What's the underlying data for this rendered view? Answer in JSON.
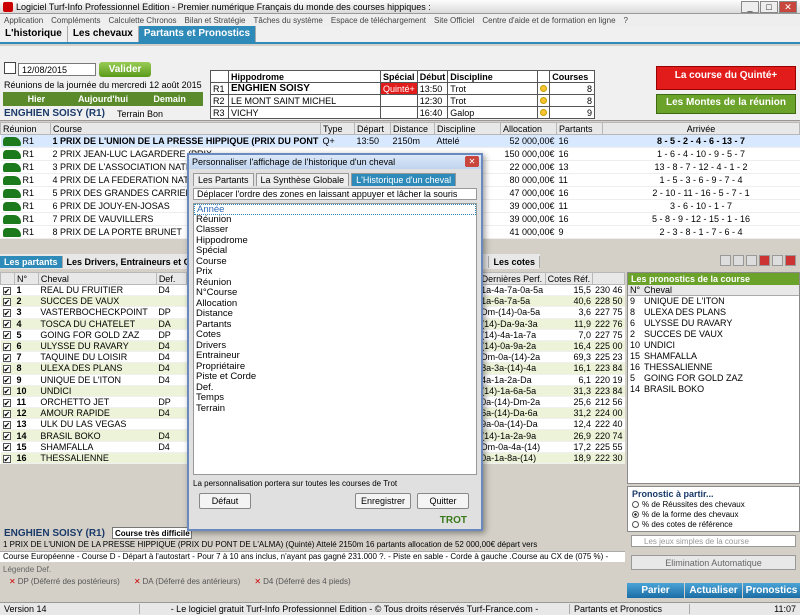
{
  "window": {
    "title": "Logiciel Turf-Info Professionnel Edition - Premier numérique Français du monde des courses hippiques :"
  },
  "menu": [
    "Application",
    "Compléments",
    "Calculette Chronos",
    "Bilan et Stratégie",
    "Tâches du système",
    "Espace de téléchargement",
    "Site Officiel",
    "Centre d'aide et de formation en ligne",
    "?"
  ],
  "tabs": [
    "L'historique",
    "Les chevaux",
    "Partants et Pronostics"
  ],
  "toolbar": {
    "date": "12/08/2015",
    "valider": "Valider",
    "reunions_date": "Réunions de la journée du mercredi 12 août 2015",
    "nav": [
      "Hier",
      "Aujourd'hui",
      "Demain"
    ],
    "hippodrome_title": "ENGHIEN SOISY (R1)",
    "terrain": "Terrain Bon"
  },
  "hippo_table": {
    "headers": [
      "",
      "Hippodrome",
      "Spécial",
      "Début",
      "Discipline",
      "",
      "Courses"
    ],
    "rows": [
      {
        "r": "R1",
        "name": "ENGHIEN SOISY",
        "special": "Quinté+",
        "debut": "13:50",
        "disc": "Trot",
        "courses": "8"
      },
      {
        "r": "R2",
        "name": "LE MONT SAINT MICHEL",
        "special": "",
        "debut": "12:30",
        "disc": "Trot",
        "courses": "8"
      },
      {
        "r": "R3",
        "name": "VICHY",
        "special": "",
        "debut": "16:40",
        "disc": "Galop",
        "courses": "9"
      }
    ]
  },
  "side_buttons": {
    "quinte": "La course du Quinté+",
    "montes": "Les Montes de la réunion"
  },
  "race_table": {
    "headers": [
      "Réunion",
      "Course",
      "Type",
      "Départ",
      "Distance",
      "Discipline",
      "Allocation",
      "Partants",
      "Arrivée"
    ],
    "rows": [
      {
        "r": "R1",
        "course": "1 PRIX DE L'UNION DE LA PRESSE HIPPIQUE (PRIX DU PONT ...",
        "type": "Q+",
        "depart": "13:50",
        "dist": "2150m",
        "disc": "Attelé",
        "alloc": "52 000,00€",
        "part": "16",
        "arr": "8 - 5 - 2 - 4 - 6 - 13 - 7"
      },
      {
        "r": "R1",
        "course": "2 PRIX JEAN-LUC LAGARDERE (PRIX...",
        "type": "",
        "depart": "",
        "dist": "",
        "disc": "",
        "alloc": "150 000,00€",
        "part": "16",
        "arr": "1 - 6 - 4 - 10 - 9 - 5 - 7"
      },
      {
        "r": "R1",
        "course": "3 PRIX DE L'ASSOCIATION NATIO...",
        "type": "",
        "depart": "",
        "dist": "",
        "disc": "",
        "alloc": "22 000,00€",
        "part": "13",
        "arr": "13 - 8 - 7 - 12 - 4 - 1 - 2"
      },
      {
        "r": "R1",
        "course": "4 PRIX DE LA FEDERATION NATIO...",
        "type": "",
        "depart": "",
        "dist": "",
        "disc": "",
        "alloc": "80 000,00€",
        "part": "11",
        "arr": "1 - 5 - 3 - 6 - 9 - 7 - 4"
      },
      {
        "r": "R1",
        "course": "5 PRIX DES GRANDES CARRIERES",
        "type": "",
        "depart": "",
        "dist": "",
        "disc": "",
        "alloc": "47 000,00€",
        "part": "16",
        "arr": "2 - 10 - 11 - 16 - 5 - 7 - 1"
      },
      {
        "r": "R1",
        "course": "6 PRIX DE JOUY-EN-JOSAS",
        "type": "",
        "depart": "",
        "dist": "",
        "disc": "",
        "alloc": "39 000,00€",
        "part": "11",
        "arr": "3 - 6 - 10 - 1 - 7"
      },
      {
        "r": "R1",
        "course": "7 PRIX DE VAUVILLERS",
        "type": "",
        "depart": "",
        "dist": "",
        "disc": "",
        "alloc": "39 000,00€",
        "part": "16",
        "arr": "5 - 8 - 9 - 12 - 15 - 1 - 16"
      },
      {
        "r": "R1",
        "course": "8 PRIX DE LA PORTE BRUNET",
        "type": "",
        "depart": "",
        "dist": "",
        "disc": "",
        "alloc": "41 000,00€",
        "part": "9",
        "arr": "2 - 3 - 8 - 1 - 7 - 6 - 4"
      }
    ]
  },
  "mid_tabs": [
    "Les partants",
    "Les Drivers, Entraineurs et Chev...",
    "Les cotes"
  ],
  "partants": {
    "headers": [
      "",
      "N°",
      "Cheval",
      "Def.",
      "",
      "Dernières Perf.",
      "Cotes Réf.",
      ""
    ],
    "rows": [
      {
        "n": "1",
        "cheval": "REAL DU FRUITIER",
        "def": "D4",
        "perf": "1a-4a-7a-0a-5a",
        "cote": "15,5",
        "x": "230 46"
      },
      {
        "n": "2",
        "cheval": "SUCCES DE VAUX",
        "def": "",
        "perf": "1a-6a-7a-5a",
        "cote": "40,6",
        "x": "228 50"
      },
      {
        "n": "3",
        "cheval": "VASTERBOCHECKPOINT",
        "def": "DP",
        "perf": "Dm-(14)-0a-5a",
        "cote": "3,6",
        "x": "227 75"
      },
      {
        "n": "4",
        "cheval": "TOSCA DU CHATELET",
        "def": "DA",
        "perf": "(14)-Da-9a-3a",
        "cote": "11,9",
        "x": "222 76"
      },
      {
        "n": "5",
        "cheval": "GOING FOR GOLD ZAZ",
        "def": "DP",
        "perf": "(14)-4a-1a-7a",
        "cote": "7,0",
        "x": "227 75"
      },
      {
        "n": "6",
        "cheval": "ULYSSE DU RAVARY",
        "def": "D4",
        "perf": "(14)-0a-9a-2a",
        "cote": "16,4",
        "x": "225 00"
      },
      {
        "n": "7",
        "cheval": "TAQUINE DU LOISIR",
        "def": "D4",
        "perf": "Dm-0a-(14)-2a",
        "cote": "69,3",
        "x": "225 23"
      },
      {
        "n": "8",
        "cheval": "ULEXA DES PLANS",
        "def": "D4",
        "perf": "8a-3a-(14)-4a",
        "cote": "16,1",
        "x": "223 84"
      },
      {
        "n": "9",
        "cheval": "UNIQUE DE L'ITON",
        "def": "D4",
        "perf": "4a-1a-2a-Da",
        "cote": "6,1",
        "x": "220 19"
      },
      {
        "n": "10",
        "cheval": "UNDICI",
        "def": "",
        "perf": "(14)-1a-6a-5a",
        "cote": "31,3",
        "x": "223 84"
      },
      {
        "n": "11",
        "cheval": "ORCHETTO JET",
        "def": "DP",
        "perf": "0a-(14)-Dm-2a",
        "cote": "25,6",
        "x": "212 56"
      },
      {
        "n": "12",
        "cheval": "AMOUR RAPIDE",
        "def": "D4",
        "perf": "6a-(14)-Da-6a",
        "cote": "31,2",
        "x": "224 00"
      },
      {
        "n": "13",
        "cheval": "ULK DU LAS VEGAS",
        "def": "",
        "perf": "9a-0a-(14)-Da",
        "cote": "12,4",
        "x": "222 40"
      },
      {
        "n": "14",
        "cheval": "BRASIL BOKO",
        "def": "D4",
        "perf": "(14)-1a-2a-9a",
        "cote": "26,9",
        "x": "220 74"
      },
      {
        "n": "15",
        "cheval": "SHAMFALLA",
        "def": "D4",
        "perf": "Dm-0a-4a-(14)",
        "cote": "17,2",
        "x": "225 55"
      },
      {
        "n": "16",
        "cheval": "THESSALIENNE",
        "def": "",
        "perf": "0a-1a-8a-(14)",
        "cote": "18,9",
        "x": "222 30"
      }
    ]
  },
  "pronostics": {
    "title": "Les pronostics de la course",
    "headers": [
      "N°",
      "Cheval"
    ],
    "rows": [
      {
        "n": "9",
        "cheval": "UNIQUE DE L'ITON"
      },
      {
        "n": "8",
        "cheval": "ULEXA DES PLANS"
      },
      {
        "n": "6",
        "cheval": "ULYSSE DU RAVARY"
      },
      {
        "n": "2",
        "cheval": "SUCCES DE VAUX"
      },
      {
        "n": "10",
        "cheval": "UNDICI"
      },
      {
        "n": "15",
        "cheval": "SHAMFALLA"
      },
      {
        "n": "16",
        "cheval": "THESSALIENNE"
      },
      {
        "n": "5",
        "cheval": "GOING FOR GOLD ZAZ"
      },
      {
        "n": "14",
        "cheval": "BRASIL BOKO"
      }
    ]
  },
  "pronos_choice": {
    "title": "Pronostic à partir...",
    "options": [
      "% de Réussites des chevaux",
      "% de la forme des chevaux",
      "% des cotes de référence"
    ]
  },
  "search": {
    "placeholder": "Les jeux simples de la course"
  },
  "elimination": "Elimination Automatique",
  "bottom_buttons": [
    "Parier",
    "Actualiser",
    "Pronostics"
  ],
  "course_info": {
    "hippo": "ENGHIEN SOISY (R1)",
    "cours_btn": "Course très difficile",
    "line1": "1 PRIX DE L'UNION DE LA PRESSE HIPPIQUE (PRIX DU PONT DE L'ALMA) (Quinté) Attelé 2150m 16 partants allocation de 52 000,00€ départ vers",
    "line2": "Course Européenne - Course D - Départ à l'autostart - Pour 7 à 10 ans inclus, n'ayant pas gagné 231.000 ?. - Piste en sable - Corde à gauche .Course au CX de (075 %) -"
  },
  "legend": {
    "title": "Légende Def.",
    "items": [
      "DP (Déferré des postérieurs)",
      "DA (Déferré des antérieurs)",
      "D4 (Déferré des 4 pieds)"
    ]
  },
  "status": [
    "Version 14",
    "- Le logiciel gratuit Turf-Info Professionnel Edition - © Tous droits réservés Turf-France.com -",
    "Partants et Pronostics",
    "11:07"
  ],
  "dialog": {
    "title": "Personnaliser l'affichage de l'historique d'un cheval",
    "tabs": [
      "Les Partants",
      "La Synthèse Globale",
      "L'Historique d'un cheval"
    ],
    "hint": "Déplacer l'ordre des zones en laissant appuyer et lâcher la souris",
    "items": [
      "Année",
      "Réunion",
      "Classer",
      "Hippodrome",
      "Spécial",
      "Course",
      "Prix",
      "Réunion",
      "N°Course",
      "Allocation",
      "Distance",
      "Partants",
      "Cotes",
      "Drivers",
      "Entraineur",
      "Propriétaire",
      "Piste et Corde",
      "Def.",
      "Temps",
      "Terrain"
    ],
    "note": "La personnalisation portera sur toutes les courses de Trot",
    "btn_default": "Défaut",
    "btn_save": "Enregistrer",
    "btn_quit": "Quitter",
    "discipline": "TROT"
  }
}
